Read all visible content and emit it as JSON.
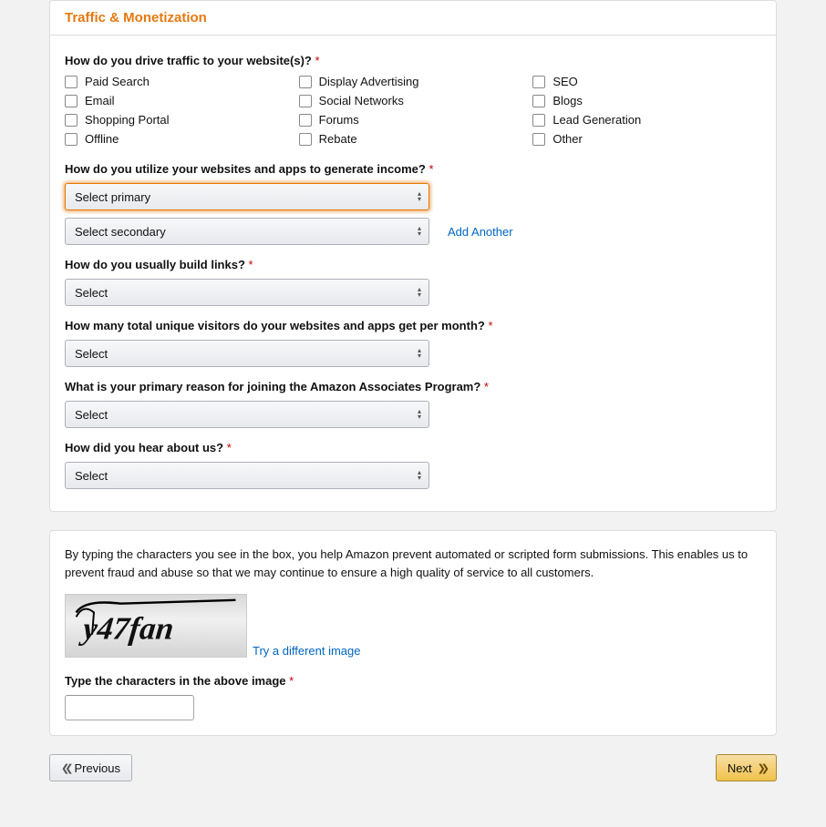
{
  "panelTitle": "Traffic & Monetization",
  "q1": {
    "label": "How do you drive traffic to your website(s)?",
    "options": [
      "Paid Search",
      "Display Advertising",
      "SEO",
      "Email",
      "Social Networks",
      "Blogs",
      "Shopping Portal",
      "Forums",
      "Lead Generation",
      "Offline",
      "Rebate",
      "Other"
    ]
  },
  "q2": {
    "label": "How do you utilize your websites and apps to generate income?",
    "primary": "Select primary",
    "secondary": "Select secondary",
    "addAnother": "Add Another"
  },
  "q3": {
    "label": "How do you usually build links?",
    "value": "Select"
  },
  "q4": {
    "label": "How many total unique visitors do your websites and apps get per month?",
    "value": "Select"
  },
  "q5": {
    "label": "What is your primary reason for joining the Amazon Associates Program?",
    "value": "Select"
  },
  "q6": {
    "label": "How did you hear about us?",
    "value": "Select"
  },
  "captcha": {
    "intro": "By typing the characters you see in the box, you help Amazon prevent automated or scripted form submissions. This enables us to prevent fraud and abuse so that we may continue to ensure a high quality of service to all customers.",
    "tryDifferent": "Try a different image",
    "inputLabel": "Type the characters in the above image",
    "imageText": "y47fan"
  },
  "nav": {
    "previous": "Previous",
    "next": "Next"
  }
}
